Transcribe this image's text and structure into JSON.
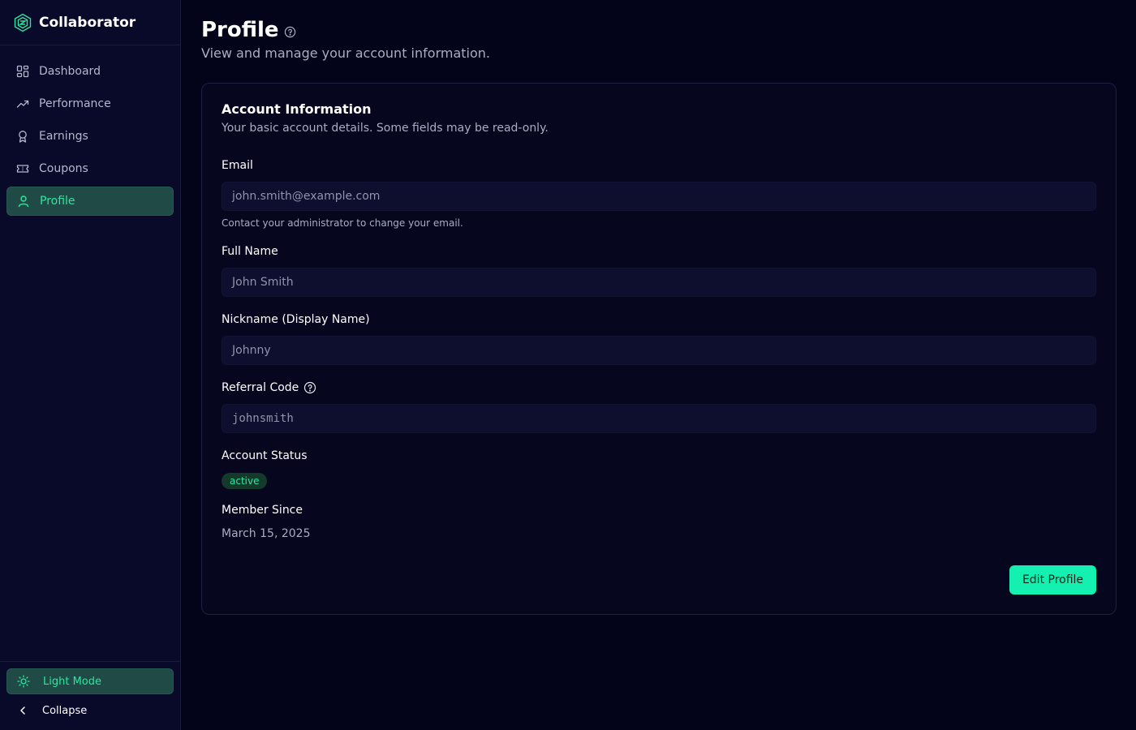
{
  "app": {
    "name": "Collaborator"
  },
  "sidebar": {
    "items": [
      {
        "label": "Dashboard",
        "icon": "dashboard-icon"
      },
      {
        "label": "Performance",
        "icon": "trending-up-icon"
      },
      {
        "label": "Earnings",
        "icon": "award-icon"
      },
      {
        "label": "Coupons",
        "icon": "ticket-icon"
      },
      {
        "label": "Profile",
        "icon": "user-icon",
        "active": true
      }
    ],
    "mode_label": "Light Mode",
    "collapse_label": "Collapse"
  },
  "page": {
    "title": "Profile",
    "subtitle": "View and manage your account information."
  },
  "card": {
    "title": "Account Information",
    "description": "Your basic account details. Some fields may be read-only.",
    "email": {
      "label": "Email",
      "value": "john.smith@example.com",
      "hint": "Contact your administrator to change your email."
    },
    "full_name": {
      "label": "Full Name",
      "value": "John Smith"
    },
    "nickname": {
      "label": "Nickname (Display Name)",
      "value": "Johnny"
    },
    "referral": {
      "label": "Referral Code",
      "value": "johnsmith"
    },
    "status": {
      "label": "Account Status",
      "value": "active"
    },
    "member_since": {
      "label": "Member Since",
      "value": "March 15, 2025"
    },
    "edit_button": "Edit Profile"
  },
  "colors": {
    "accent": "#14f0b0",
    "active_text": "#2ee6a0",
    "background": "#03031a"
  }
}
